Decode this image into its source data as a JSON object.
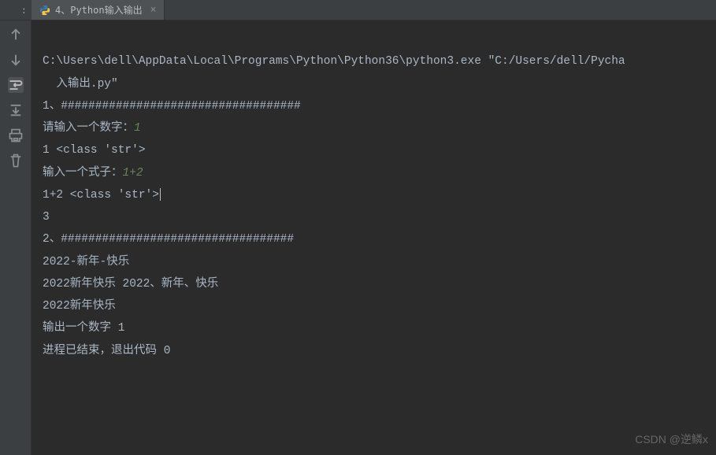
{
  "run_label": ":",
  "tab": {
    "icon": "python-icon",
    "title": "4、Python输入输出",
    "close": "×"
  },
  "gutter_icons": {
    "up": "↑",
    "down": "↓",
    "wrap": "wrap",
    "scroll": "scroll",
    "print": "print",
    "trash": "trash"
  },
  "console": {
    "line1a": "C:\\Users\\dell\\AppData\\Local\\Programs\\Python\\Python36\\python3.exe \"C:/Users/dell/Pycha",
    "line1b": "  入输出.py\"",
    "line2": "1、###################################",
    "line3_prefix": "请输入一个数字：",
    "line3_input": "1",
    "line4": "1 <class 'str'>",
    "line5_prefix": "输入一个式子：",
    "line5_input": "1+2",
    "line6": "1+2 <class 'str'>",
    "line7": "3",
    "line8": "2、##################################",
    "line9": "2022-新年-快乐",
    "line10": "2022新年快乐 2022、新年、快乐",
    "line11": "2022新年快乐",
    "line12": "输出一个数字 1",
    "line13": "",
    "line14": "进程已结束，退出代码 0"
  },
  "watermark": "CSDN @逆鳞x"
}
